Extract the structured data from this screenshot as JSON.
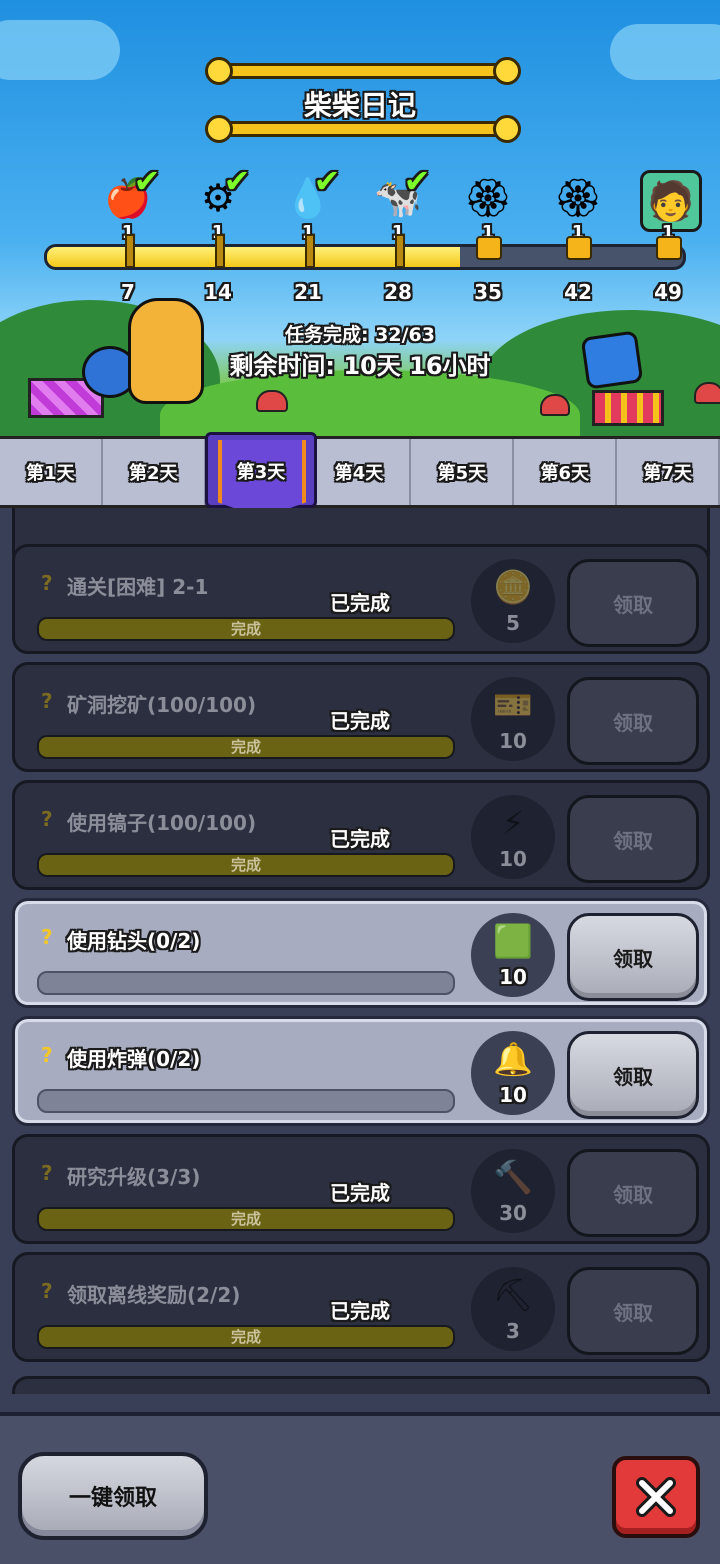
{
  "header": {
    "title": "柴柴日记",
    "tasks_done": "任务完成: 32/63",
    "time_left": "剩余时间: 10天 16小时",
    "progress": 0.65
  },
  "milestones": [
    {
      "day": "7",
      "count": "1",
      "icon": "red-apple-icon",
      "claimed": true
    },
    {
      "day": "14",
      "count": "1",
      "icon": "purple-saw-icon",
      "claimed": true
    },
    {
      "day": "21",
      "count": "1",
      "icon": "blue-bulb-icon",
      "claimed": true
    },
    {
      "day": "28",
      "count": "1",
      "icon": "cow-chef-icon",
      "claimed": true
    },
    {
      "day": "35",
      "count": "1",
      "icon": "golden-lotus-icon",
      "locked": true
    },
    {
      "day": "42",
      "count": "1",
      "icon": "golden-lotus-icon",
      "locked": true
    },
    {
      "day": "49",
      "count": "1",
      "icon": "hero-portrait-icon",
      "locked": true
    }
  ],
  "tabs": [
    "第1天",
    "第2天",
    "第3天",
    "第4天",
    "第5天",
    "第6天",
    "第7天"
  ],
  "active_tab": 2,
  "tasks": [
    {
      "name": "通关[困难] 2-1",
      "status": "已完成",
      "bar_label": "完成",
      "reward_icon": "coin-compass-icon",
      "reward_count": "5",
      "claim": "领取",
      "state": "done"
    },
    {
      "name": "矿洞挖矿(100/100)",
      "status": "已完成",
      "bar_label": "完成",
      "reward_icon": "teal-ticket-icon",
      "reward_count": "10",
      "claim": "领取",
      "state": "done"
    },
    {
      "name": "使用镐子(100/100)",
      "status": "已完成",
      "bar_label": "完成",
      "reward_icon": "lightning-ticket-icon",
      "reward_count": "10",
      "claim": "领取",
      "state": "done"
    },
    {
      "name": "使用钻头(0/2)",
      "status": "",
      "bar_label": "",
      "reward_icon": "green-ticket-icon",
      "reward_count": "10",
      "claim": "领取",
      "state": "active"
    },
    {
      "name": "使用炸弹(0/2)",
      "status": "",
      "bar_label": "",
      "reward_icon": "blue-bell-ticket-icon",
      "reward_count": "10",
      "claim": "领取",
      "state": "active"
    },
    {
      "name": "研究升级(3/3)",
      "status": "已完成",
      "bar_label": "完成",
      "reward_icon": "hammer-icon",
      "reward_count": "30",
      "claim": "领取",
      "state": "done"
    },
    {
      "name": "领取离线奖励(2/2)",
      "status": "已完成",
      "bar_label": "完成",
      "reward_icon": "pickaxe-icon",
      "reward_count": "3",
      "claim": "领取",
      "state": "done"
    }
  ],
  "bottom": {
    "claim_all": "一键领取"
  },
  "colors": {
    "accent_yellow": "#f5c81a",
    "tab_active": "#6b48d8",
    "close_red": "#e23a3a"
  }
}
